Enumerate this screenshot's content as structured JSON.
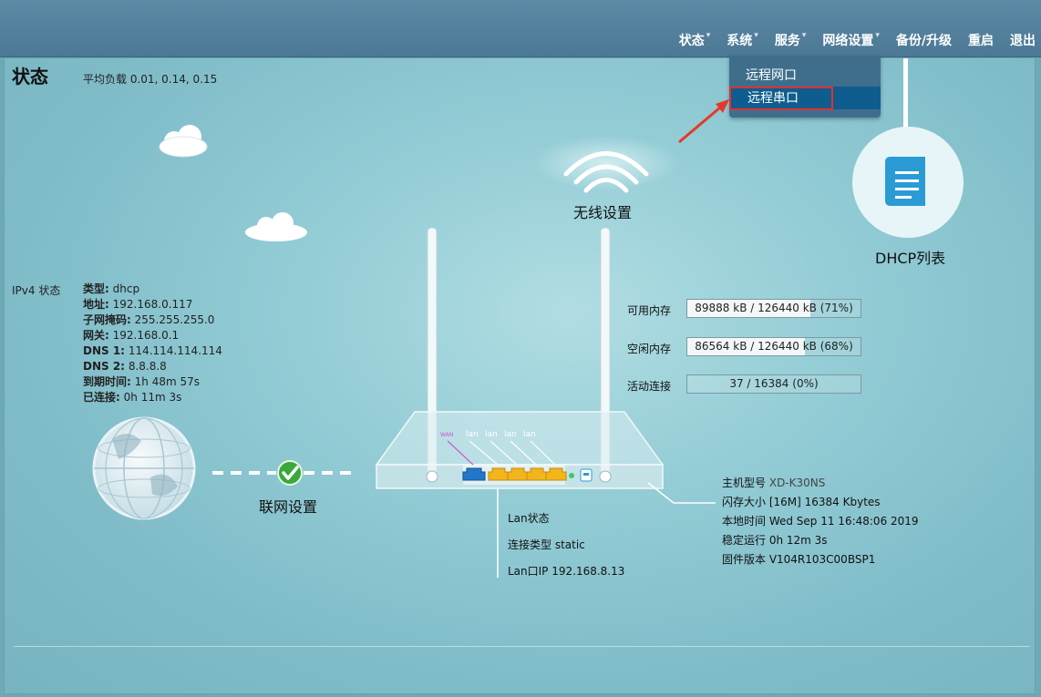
{
  "nav": {
    "items": [
      {
        "label": "状态",
        "has_caret": true
      },
      {
        "label": "系统",
        "has_caret": true
      },
      {
        "label": "服务",
        "has_caret": true
      },
      {
        "label": "网络设置",
        "has_caret": true
      },
      {
        "label": "备份/升级",
        "has_caret": false
      },
      {
        "label": "重启",
        "has_caret": false
      },
      {
        "label": "退出",
        "has_caret": false
      }
    ],
    "caret_glyph": "▾",
    "dropdown": [
      "远程网口",
      "远程串口"
    ]
  },
  "page": {
    "title": "状态",
    "load_average": "平均负载 0.01, 0.14, 0.15"
  },
  "ipv4": {
    "label": "IPv4 状态",
    "rows": [
      {
        "k": "类型:",
        "v": "dhcp"
      },
      {
        "k": "地址:",
        "v": "192.168.0.117"
      },
      {
        "k": "子网掩码:",
        "v": "255.255.255.0"
      },
      {
        "k": "网关:",
        "v": "192.168.0.1"
      },
      {
        "k": "DNS 1:",
        "v": "114.114.114.114"
      },
      {
        "k": "DNS 2:",
        "v": "8.8.8.8"
      },
      {
        "k": "到期时间:",
        "v": "1h 48m 57s"
      },
      {
        "k": "已连接:",
        "v": "0h 11m 3s"
      }
    ]
  },
  "labels": {
    "network_setup": "联网设置",
    "wireless_setup": "无线设置",
    "dhcp_list": "DHCP列表"
  },
  "stats": [
    {
      "label": "可用内存",
      "text": "89888 kB / 126440 kB (71%)",
      "fraction": 0.71
    },
    {
      "label": "空闲内存",
      "text": "86564 kB / 126440 kB (68%)",
      "fraction": 0.68
    },
    {
      "label": "活动连接",
      "text": "37 / 16384 (0%)",
      "fraction": 0.0
    }
  ],
  "router_ports": {
    "wan": "WAN",
    "lan": [
      "lan",
      "lan",
      "lan",
      "lan"
    ]
  },
  "lan": {
    "status": "Lan状态",
    "conn_type": "连接类型 static",
    "ip": "Lan口IP 192.168.8.13"
  },
  "device": {
    "model_label": "主机型号",
    "model_value": "XD-K30NS",
    "flash": "闪存大小 [16M] 16384 Kbytes",
    "local_time": "本地时间 Wed Sep 11 16:48:06 2019",
    "uptime": "稳定运行 0h 12m 3s",
    "firmware": "固件版本 V104R103C00BSP1"
  },
  "colors": {
    "accent": "#0f5d8f",
    "highlight_border": "#e03030",
    "check_green": "#3aa83a",
    "port_yellow": "#f2b51c",
    "dhcp_icon": "#2b9bd6"
  },
  "icons": [
    "cloud-icon",
    "globe-icon",
    "check-icon",
    "wifi-icon",
    "document-icon",
    "router-icon",
    "arrow-icon"
  ]
}
